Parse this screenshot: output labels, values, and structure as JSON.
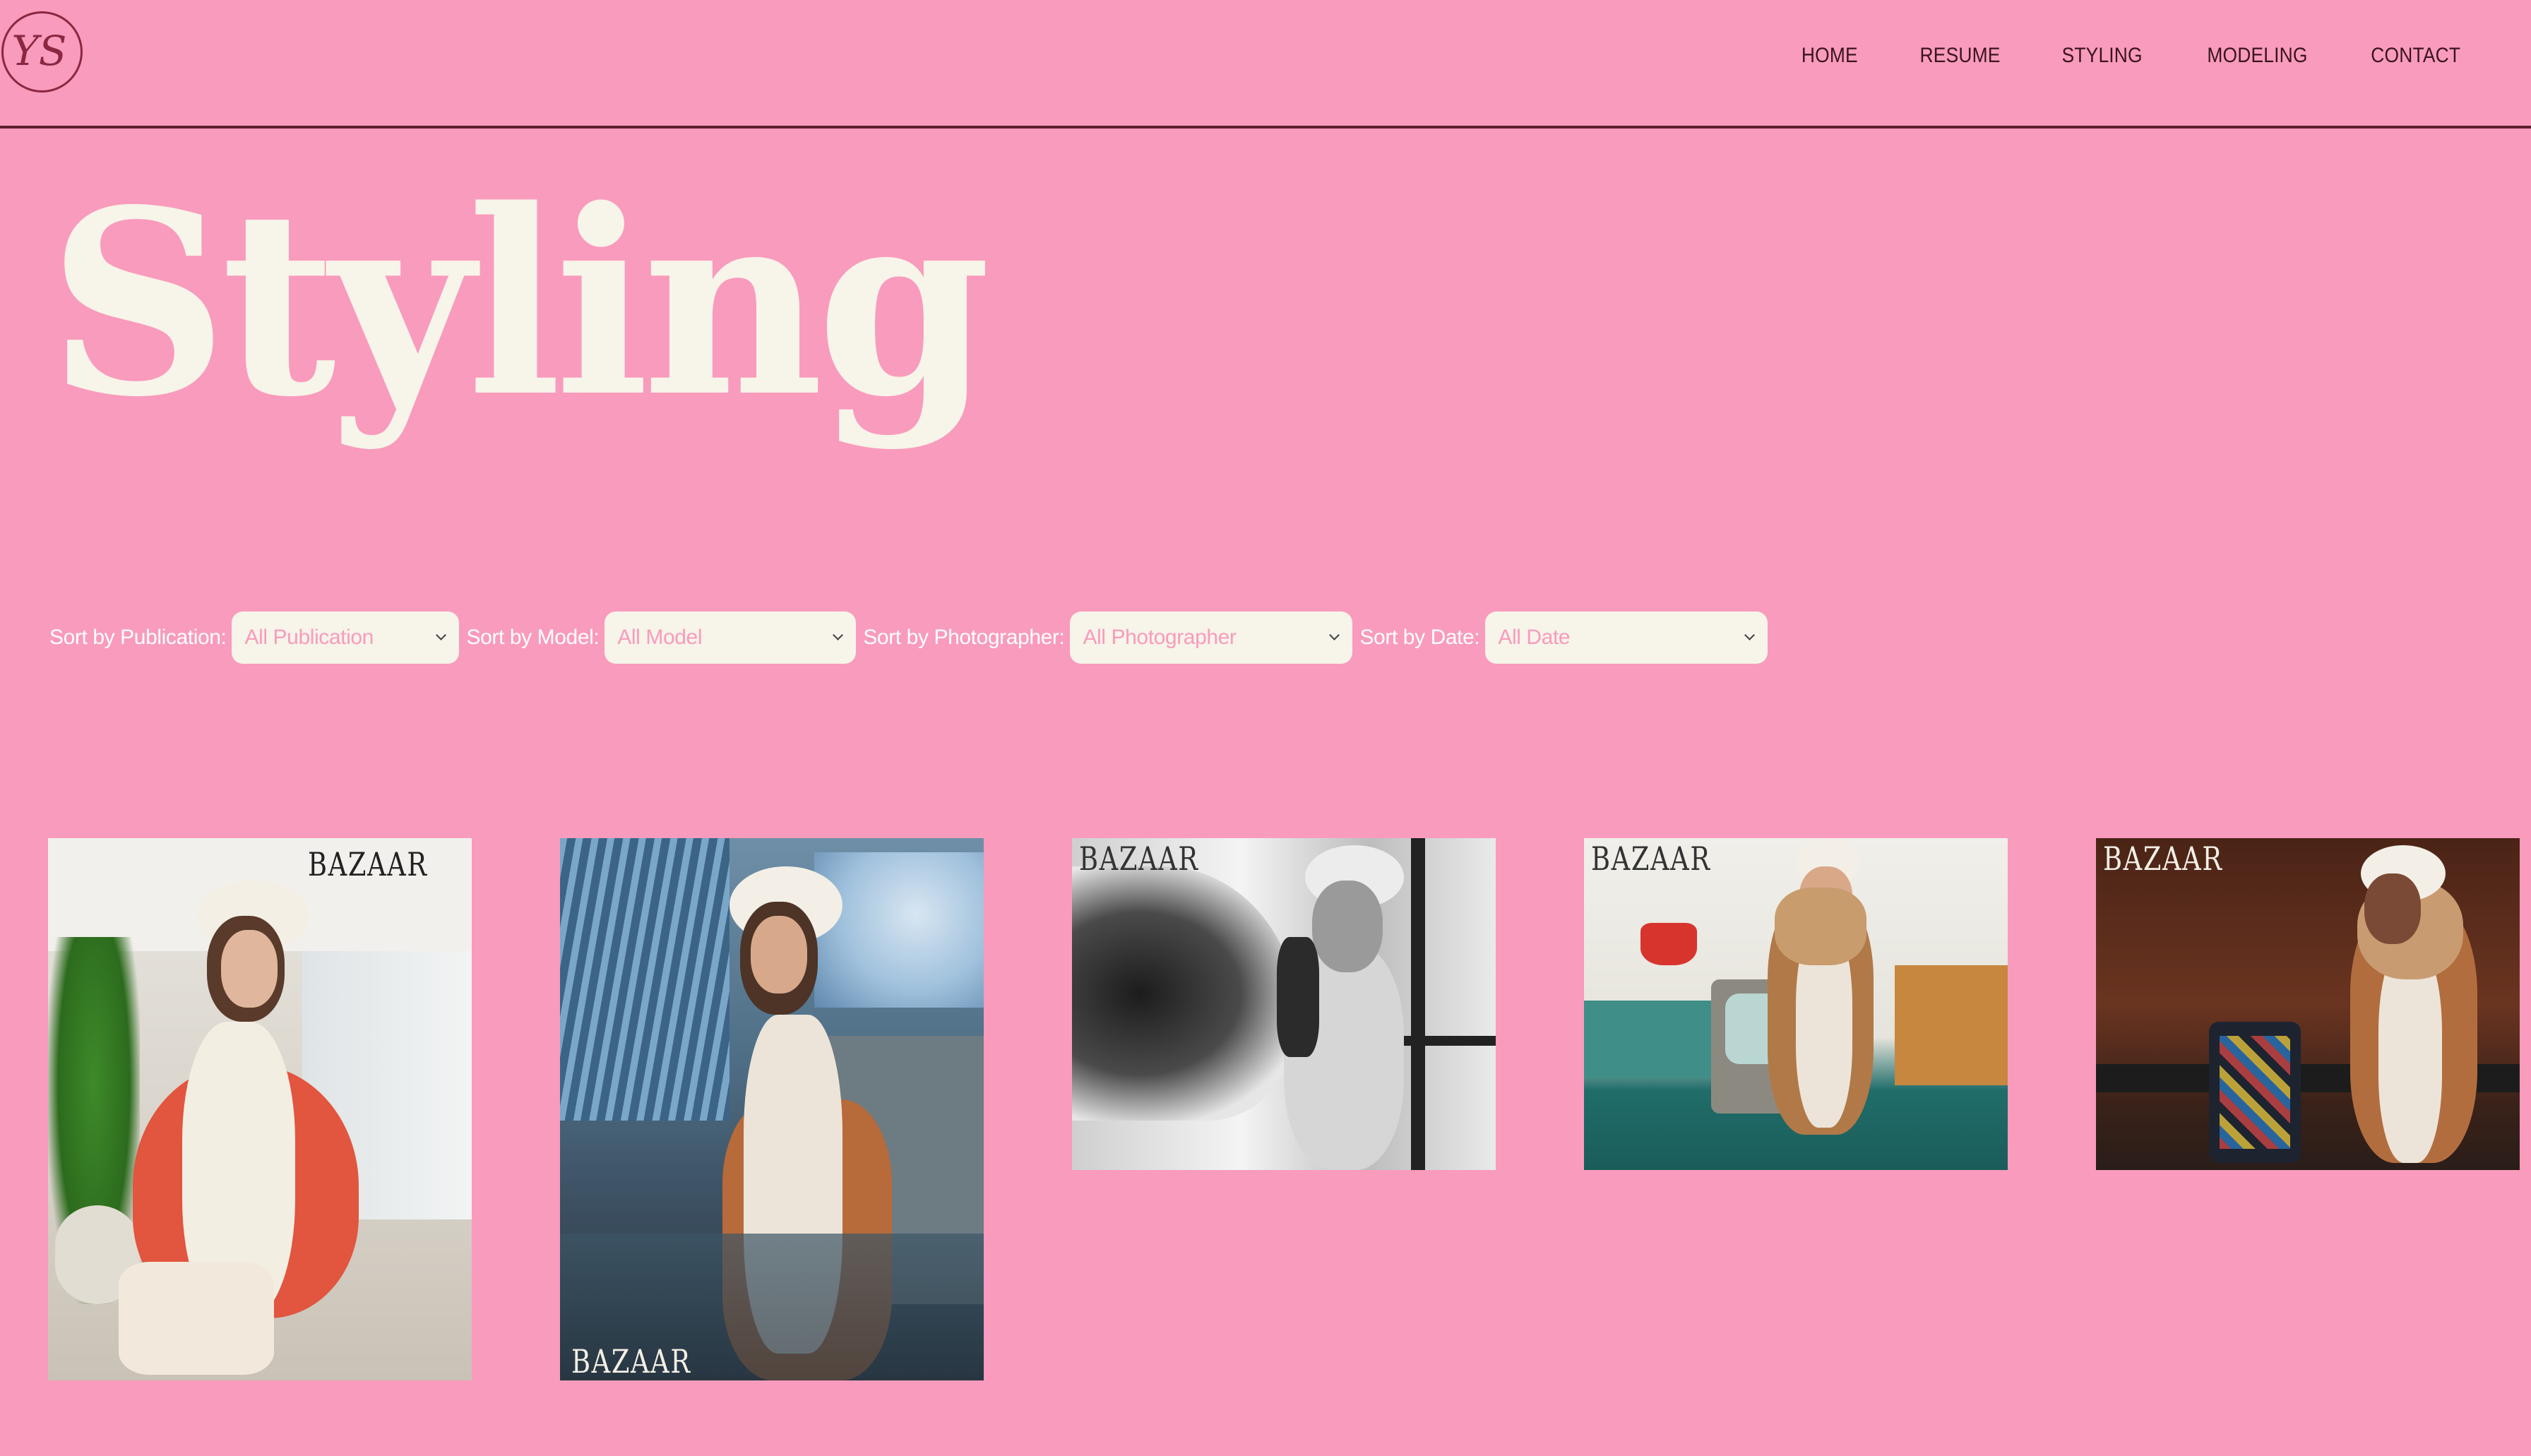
{
  "brand": {
    "logo_text": "YS"
  },
  "nav": {
    "items": [
      {
        "label": "HOME"
      },
      {
        "label": "RESUME"
      },
      {
        "label": "STYLING"
      },
      {
        "label": "MODELING"
      },
      {
        "label": "CONTACT"
      }
    ]
  },
  "page": {
    "title": "Styling"
  },
  "filters": [
    {
      "label": "Sort by Publication:",
      "selected": "All Publication"
    },
    {
      "label": "Sort by Model:",
      "selected": "All Model"
    },
    {
      "label": "Sort by Photographer:",
      "selected": "All Photographer"
    },
    {
      "label": "Sort by Date:",
      "selected": "All Date"
    }
  ],
  "gallery": [
    {
      "masthead": "BAZAAR"
    },
    {
      "masthead": "BAZAAR"
    },
    {
      "masthead": "BAZAAR"
    },
    {
      "masthead": "BAZAAR"
    },
    {
      "masthead": "BAZAAR"
    }
  ],
  "colors": {
    "background": "#f99bbc",
    "title": "#f7f4ea",
    "nav_text": "#3a1420",
    "rule": "#5a1f2e",
    "select_bg": "#f7f4ea"
  }
}
